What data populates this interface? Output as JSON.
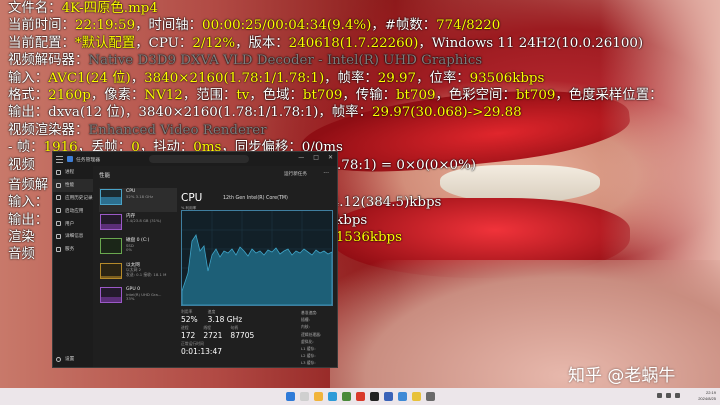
{
  "osd": {
    "line1": {
      "label": "文件名：",
      "value": "4K-四原色.mp4"
    },
    "line2": {
      "label": "当前时间：",
      "time": "22:19:59",
      "sep1": "，时间轴：",
      "timeline": "00:00:25/00:04:34(9.4%)",
      "sep2": "，#帧数：",
      "frames": "774/8220"
    },
    "line3": {
      "label": "当前配置：",
      "config": "*默认配置",
      "sep1": "，CPU：",
      "cpu": "2/12%",
      "sep2": "，版本：",
      "version": "240618(1.7.22260)",
      "sep3": "，",
      "os": "Windows 11 24H2(10.0.26100)"
    },
    "line4": {
      "label": "视频解码器：",
      "value": "Native D3D9 DXVA VLD Decoder - Intel(R) UHD Graphics"
    },
    "line5": {
      "label": "输入：",
      "codec": "AVC1(24 位)",
      "sep1": "，",
      "res": "3840×2160(1.78:1/1.78:1)",
      "sep2": "，帧率：",
      "fps": "29.97",
      "sep3": "，位率：",
      "bitrate": "93506kbps"
    },
    "line6": {
      "label": "格式：",
      "fmt": "2160p",
      "sep1": "，像素：",
      "pix": "NV12",
      "sep2": "，范围：",
      "range": "tv",
      "sep3": "，色域：",
      "prim": "bt709",
      "sep4": "，传输：",
      "trc": "bt709",
      "sep5": "，色彩空间：",
      "space": "bt709",
      "sep6": "，色度采样位置："
    },
    "line7": {
      "label": "输出：",
      "dx": "dxva(12 位)",
      "sep1": "，3840×2160(1.78:1/1.78:1)，帧率：",
      "fps": "29.97(30.068)->29.88"
    },
    "line8": {
      "label": "视频渲染器：",
      "value": "Enhanced Video Renderer"
    },
    "line9": {
      "label": " - 帧：",
      "frames": "1916",
      "sep1": "，丢帧：",
      "dropped": "0",
      "sep2": "，抖动：",
      "jitter": "0ms",
      "sep3": "，同步偏移：",
      "sync": "0/0ms"
    },
    "line10": {
      "label": "视频",
      "tail": "0(1.78:1) = 0×0(0×0%)"
    },
    "line11": {
      "label": "音频解"
    },
    "line12": {
      "label": "输入：",
      "tail": "84.12(384.5)kbps"
    },
    "line13": {
      "label": "输出：",
      "tail": "kbps"
    },
    "line14": {
      "label": "渲染",
      "tail": "1536kbps"
    },
    "line15": {
      "label": "音频"
    }
  },
  "task_manager": {
    "title": "任务管理器",
    "nav": [
      {
        "label": "进程"
      },
      {
        "label": "性能"
      },
      {
        "label": "应用历史记录"
      },
      {
        "label": "启动应用"
      },
      {
        "label": "用户"
      },
      {
        "label": "详细信息"
      },
      {
        "label": "服务"
      }
    ],
    "settings": "设置",
    "pane_title": "性能",
    "run_task": "运行新任务",
    "devices": [
      {
        "name": "CPU",
        "sub": "52% 3.18 GHz",
        "fill": 0.52
      },
      {
        "name": "内存",
        "sub": "7.4/23.8 GB (31%)",
        "fill": 0.31
      },
      {
        "name": "磁盘 0 (C:)",
        "sub": "SSD",
        "sub2": "0%",
        "fill": 0.0
      },
      {
        "name": "以太网",
        "sub": "以太网 2",
        "sub2": "发送: 0.1 接收: 18.1 M",
        "fill": 0.1
      },
      {
        "name": "GPU 0",
        "sub": "Intel(R) UHD Gra...",
        "sub2": "33%",
        "fill": 0.33
      }
    ],
    "cpu_title": "CPU",
    "cpu_model": "12th Gen Intel(R) Core(TM)",
    "graph_label": "% 利用率",
    "stats": {
      "util_label": "利用率",
      "util": "52%",
      "speed_label": "速度",
      "speed": "3.18 GHz",
      "proc_label": "进程",
      "proc": "172",
      "thread_label": "线程",
      "thread": "2721",
      "handle_label": "句柄",
      "handle": "87705",
      "uptime_label": "正常运行时间",
      "uptime": "0:01:13:47"
    },
    "side_stats": [
      "基准速度:",
      "插槽:",
      "内核:",
      "逻辑处理器:",
      "虚拟化:",
      "L1 缓存:",
      "L2 缓存:",
      "L3 缓存:"
    ]
  },
  "taskbar": {
    "time": "22:19",
    "date": "2024/8/25"
  },
  "watermark": "知乎 @老蜗牛"
}
